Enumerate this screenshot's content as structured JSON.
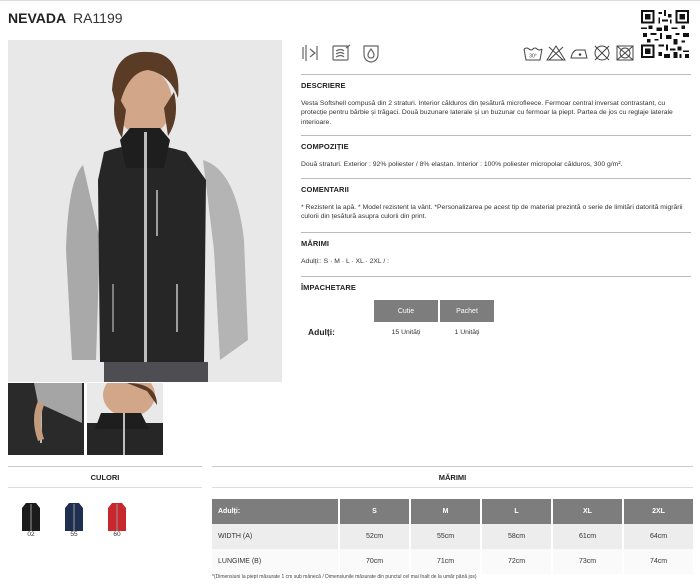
{
  "product": {
    "name": "NEVADA",
    "code": "RA1199"
  },
  "feature_icons": [
    "wind-resistant-icon",
    "breathable-icon",
    "water-resistant-icon"
  ],
  "care_icons": [
    "wash-30-icon",
    "no-bleach-icon",
    "iron-low-icon",
    "no-dry-clean-icon",
    "no-tumble-dry-icon"
  ],
  "sections": {
    "description": {
      "title": "DESCRIERE",
      "text": "Vesta Softshell compusă din 2 straturi. Interior călduros din țesătură microfleece. Fermoar central inversat contrastant, cu protecție pentru bărbie și trăgaci. Două buzunare laterale și un buzunar cu fermoar la piept. Partea de jos cu reglaje laterale interioare."
    },
    "composition": {
      "title": "COMPOZIȚIE",
      "text": "Două straturi. Exterior : 92% poliester / 8% elastan. Interior : 100% poliester micropolar călduros, 300 g/m²."
    },
    "comments": {
      "title": "COMENTARII",
      "text": "* Rezistent la apă. * Model rezistent la vânt. *Personalizarea pe acest tip de material prezintă o serie de limitări datorită migrării culorii din țesătură asupra culorii din print."
    },
    "sizes": {
      "title": "MĂRIMI",
      "text": "Adulți:: S · M · L · XL · 2XL / :"
    },
    "packing": {
      "title": "ÎMPACHETARE",
      "col1": "Cutie",
      "col2": "Pachet",
      "row_label": "Adulți:",
      "box": "15 Unități",
      "pack": "1 Unități"
    }
  },
  "colors": {
    "title": "CULORI",
    "items": [
      {
        "code": "02",
        "hex": "#1b1b1b"
      },
      {
        "code": "55",
        "hex": "#1f2f52"
      },
      {
        "code": "60",
        "hex": "#c8272d"
      }
    ]
  },
  "size_table": {
    "title": "MĂRIMI",
    "header": [
      "Adulți:",
      "S",
      "M",
      "L",
      "XL",
      "2XL"
    ],
    "rows": [
      [
        "WIDTH (A)",
        "52cm",
        "55cm",
        "58cm",
        "61cm",
        "64cm"
      ],
      [
        "LUNGIME (B)",
        "70cm",
        "71cm",
        "72cm",
        "73cm",
        "74cm"
      ]
    ],
    "footnote": "*(Dimensiuni la piept măsurate 1 cm sub mânecă / Dimensiunile măsurate din punctul cel mai înalt de la umăr până jos)"
  }
}
